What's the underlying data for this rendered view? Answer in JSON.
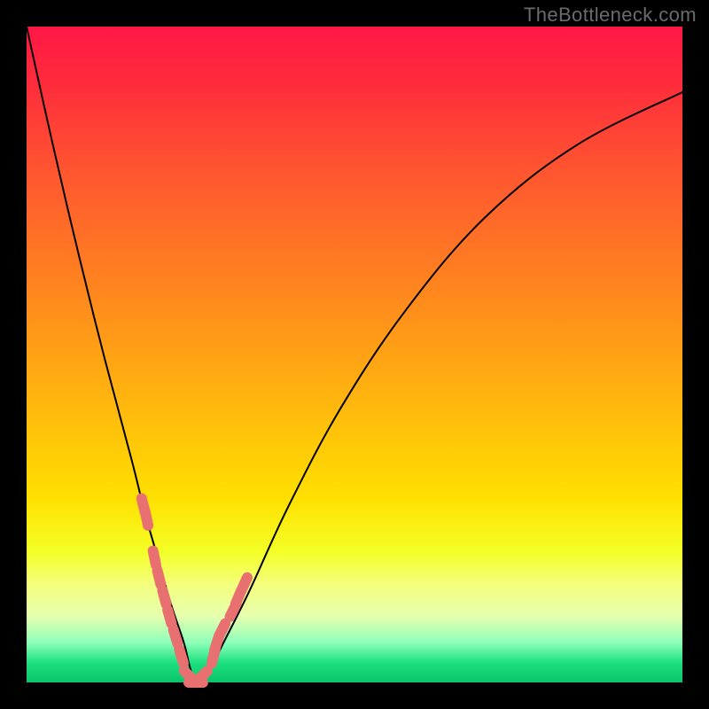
{
  "watermark": "TheBottleneck.com",
  "colors": {
    "frame_bg": "#000000",
    "marker": "#e87070",
    "curve": "#000000",
    "gradient_stops": [
      "#ff1846",
      "#ff5530",
      "#ffe000",
      "#1de080"
    ]
  },
  "chart_data": {
    "type": "line",
    "title": "",
    "xlabel": "",
    "ylabel": "",
    "xlim": [
      0,
      100
    ],
    "ylim": [
      0,
      100
    ],
    "grid": false,
    "legend": false,
    "series": [
      {
        "name": "bottleneck-curve",
        "x": [
          0,
          4,
          8,
          12,
          16,
          18,
          20,
          22,
          24,
          25,
          26,
          28,
          30,
          34,
          40,
          48,
          58,
          70,
          84,
          100
        ],
        "y": [
          100,
          82,
          65,
          49,
          34,
          26,
          19,
          12,
          6,
          2,
          0,
          2,
          6,
          14,
          27,
          42,
          57,
          71,
          82,
          90
        ]
      }
    ],
    "markers": {
      "left_arm": {
        "x": [
          17.8,
          18.3,
          19.5,
          20.2,
          21.0,
          21.8,
          22.7,
          23.6
        ],
        "y": [
          27,
          25,
          19,
          16,
          13,
          10,
          7,
          4
        ]
      },
      "bottom": {
        "x": [
          24.8,
          25.8,
          26.8
        ],
        "y": [
          1,
          0,
          1
        ]
      },
      "right_arm": {
        "x": [
          28.5,
          29.0,
          29.8,
          31.5,
          32.3,
          33.2
        ],
        "y": [
          4,
          6,
          8,
          11,
          13,
          15
        ]
      }
    }
  }
}
